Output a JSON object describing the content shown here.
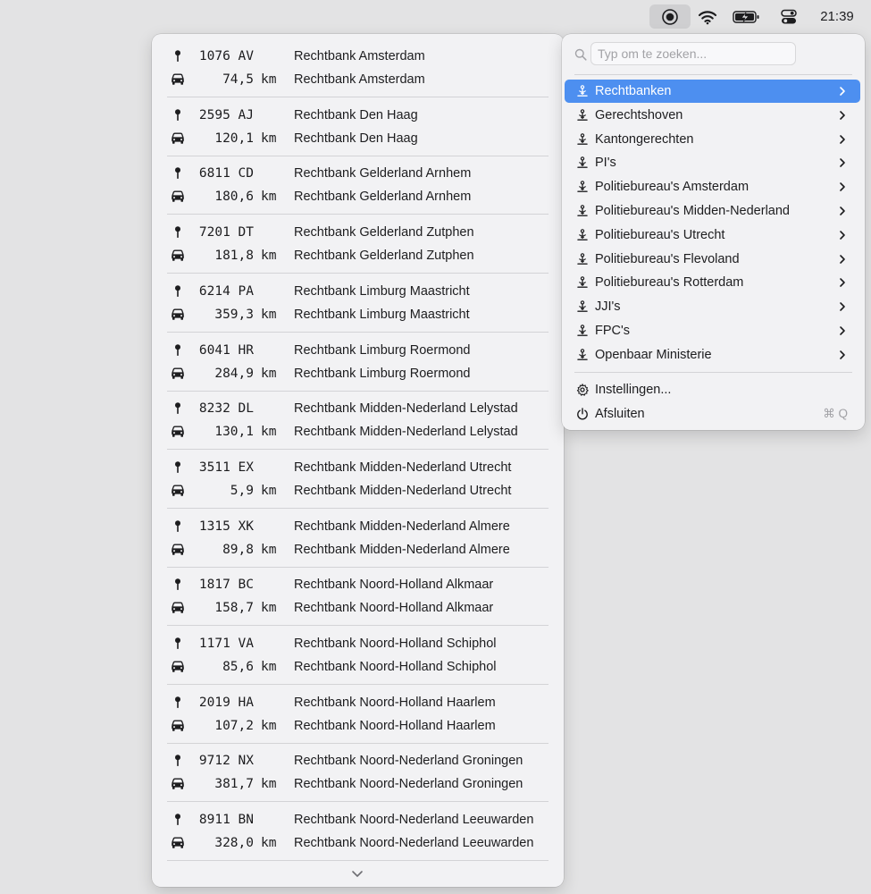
{
  "menubar": {
    "app_icon": "record-circle-icon",
    "wifi_icon": "wifi-icon",
    "battery_icon": "battery-charging-icon",
    "control_center_icon": "control-center-icon",
    "clock": "21:39"
  },
  "list": {
    "icons": {
      "postcode": "pin-icon",
      "distance": "car-icon"
    },
    "unit": "km",
    "entries": [
      {
        "postcode": "1076 AV",
        "distance": "74,5",
        "name": "Rechtbank Amsterdam"
      },
      {
        "postcode": "2595 AJ",
        "distance": "120,1",
        "name": "Rechtbank Den Haag"
      },
      {
        "postcode": "6811 CD",
        "distance": "180,6",
        "name": "Rechtbank Gelderland Arnhem"
      },
      {
        "postcode": "7201 DT",
        "distance": "181,8",
        "name": "Rechtbank Gelderland Zutphen"
      },
      {
        "postcode": "6214 PA",
        "distance": "359,3",
        "name": "Rechtbank Limburg Maastricht"
      },
      {
        "postcode": "6041 HR",
        "distance": "284,9",
        "name": "Rechtbank Limburg Roermond"
      },
      {
        "postcode": "8232 DL",
        "distance": "130,1",
        "name": "Rechtbank Midden-Nederland Lelystad"
      },
      {
        "postcode": "3511 EX",
        "distance": "5,9",
        "name": "Rechtbank Midden-Nederland Utrecht"
      },
      {
        "postcode": "1315 XK",
        "distance": "89,8",
        "name": "Rechtbank Midden-Nederland Almere"
      },
      {
        "postcode": "1817 BC",
        "distance": "158,7",
        "name": "Rechtbank Noord-Holland Alkmaar"
      },
      {
        "postcode": "1171 VA",
        "distance": "85,6",
        "name": "Rechtbank Noord-Holland Schiphol"
      },
      {
        "postcode": "2019 HA",
        "distance": "107,2",
        "name": "Rechtbank Noord-Holland Haarlem"
      },
      {
        "postcode": "9712 NX",
        "distance": "381,7",
        "name": "Rechtbank Noord-Nederland Groningen"
      },
      {
        "postcode": "8911 BN",
        "distance": "328,0",
        "name": "Rechtbank Noord-Nederland Leeuwarden"
      }
    ],
    "scroll_icon": "chevron-down-icon"
  },
  "menu": {
    "search_placeholder": "Typ om te zoeken...",
    "search_value": "",
    "category_icon": "scales-icon",
    "categories": [
      {
        "label": "Rechtbanken",
        "active": true
      },
      {
        "label": "Gerechtshoven"
      },
      {
        "label": "Kantongerechten"
      },
      {
        "label": "PI's"
      },
      {
        "label": "Politiebureau's Amsterdam"
      },
      {
        "label": "Politiebureau's Midden-Nederland"
      },
      {
        "label": "Politiebureau's Utrecht"
      },
      {
        "label": "Politiebureau's Flevoland"
      },
      {
        "label": "Politiebureau's Rotterdam"
      },
      {
        "label": "JJI's"
      },
      {
        "label": "FPC's"
      },
      {
        "label": "Openbaar Ministerie"
      }
    ],
    "settings": {
      "label": "Instellingen...",
      "icon": "gear-icon"
    },
    "quit": {
      "label": "Afsluiten",
      "icon": "power-icon",
      "shortcut": "⌘ Q"
    },
    "colors": {
      "selection": "#4d8ff0"
    }
  }
}
